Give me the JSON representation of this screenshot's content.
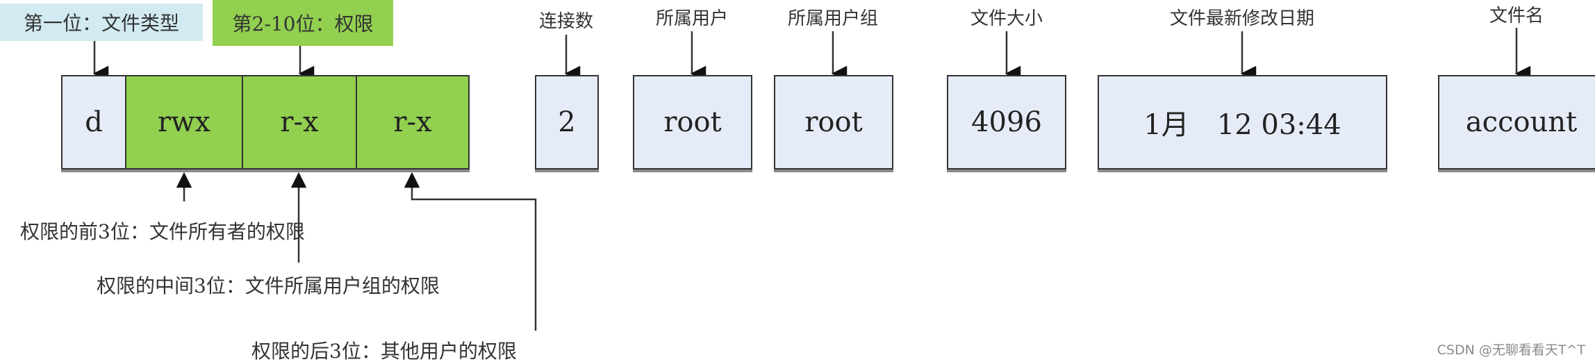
{
  "captions": {
    "file_type": "第一位：文件类型",
    "permissions": "第2-10位：权限"
  },
  "fields": {
    "type": {
      "value": "d"
    },
    "owner_perm": {
      "value": "rwx"
    },
    "group_perm": {
      "value": "r-x"
    },
    "other_perm": {
      "value": "r-x"
    },
    "links": {
      "label": "连接数",
      "value": "2"
    },
    "owner": {
      "label": "所属用户",
      "value": "root"
    },
    "group": {
      "label": "所属用户组",
      "value": "root"
    },
    "size": {
      "label": "文件大小",
      "value": "4096"
    },
    "mtime": {
      "label": "文件最新修改日期",
      "value": "1月　12 03:44"
    },
    "name": {
      "label": "文件名",
      "value": "account"
    }
  },
  "annotations": {
    "owner": "权限的前3位：文件所有者的权限",
    "group": "权限的中间3位：文件所属用户组的权限",
    "other": "权限的后3位：其他用户的权限"
  },
  "watermark": "CSDN @无聊看看天T^T",
  "colors": {
    "type_caption_bg": "#d2eaf1",
    "perm_green": "#92d050",
    "cell_light": "#e6ecf7"
  }
}
